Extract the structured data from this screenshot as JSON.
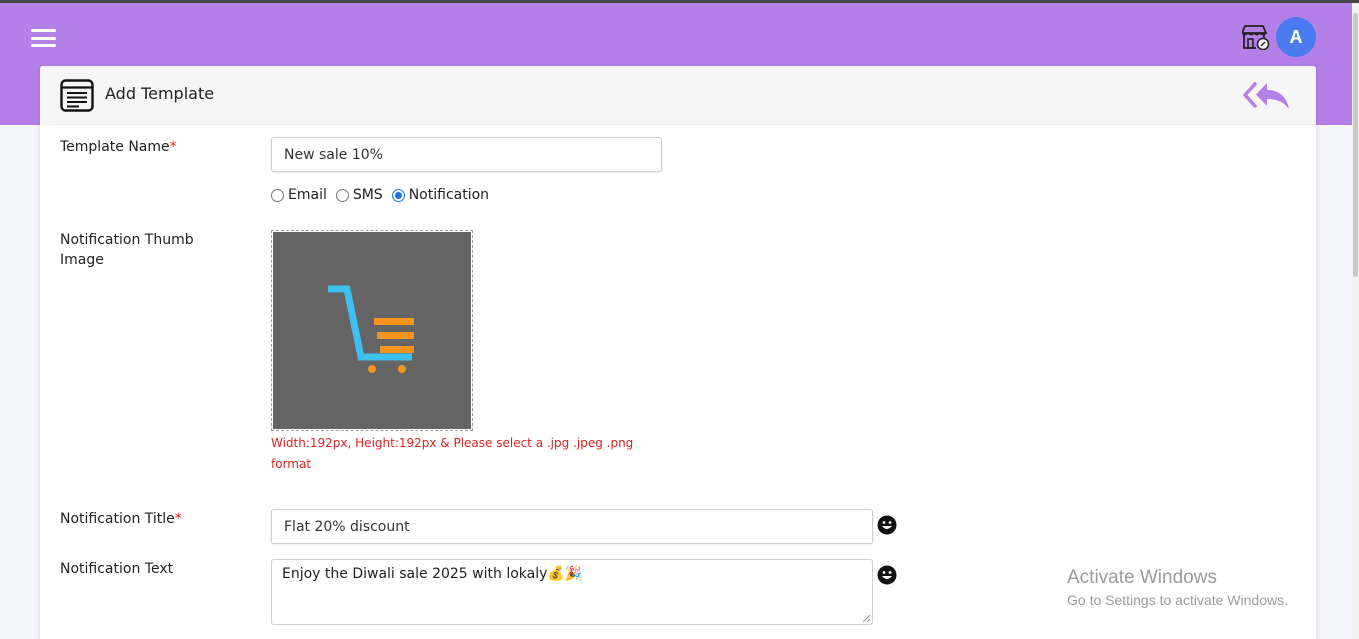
{
  "header": {
    "avatar_letter": "A",
    "colors": {
      "header_bg": "#b57fe8",
      "avatar_bg": "#4a7bee"
    },
    "icons": [
      "hamburger-menu-icon",
      "store-icon"
    ]
  },
  "card": {
    "title": "Add Template",
    "icons": [
      "template-icon",
      "back-reply-all-icon"
    ]
  },
  "form": {
    "template_name": {
      "label": "Template Name",
      "required_mark": "*",
      "value": "New sale 10%"
    },
    "type_options": [
      {
        "label": "Email",
        "selected": false
      },
      {
        "label": "SMS",
        "selected": false
      },
      {
        "label": "Notification",
        "selected": true
      }
    ],
    "thumb_image": {
      "label": "Notification Thumb Image",
      "hint_line1": "Width:192px, Height:192px & Please select a .jpg .jpeg .png",
      "hint_line2": "format",
      "icon": "shopping-cart-icon"
    },
    "notification_title": {
      "label": "Notification Title",
      "required_mark": "*",
      "value": "Flat 20% discount"
    },
    "notification_text": {
      "label": "Notification Text",
      "value": "Enjoy the Diwali sale 2025 with lokaly💰🎉"
    }
  },
  "watermark": {
    "line1": "Activate Windows",
    "line2": "Go to Settings to activate Windows."
  }
}
